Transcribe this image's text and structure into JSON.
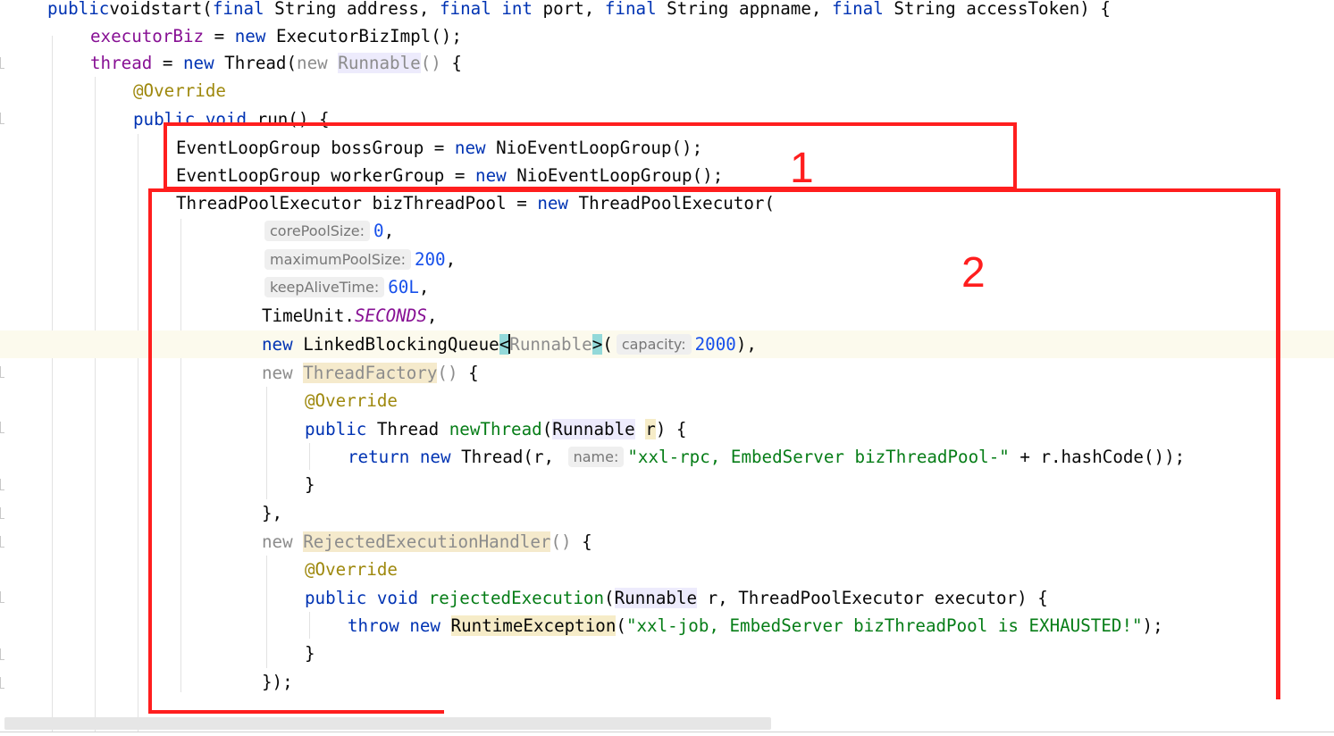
{
  "editor": {
    "lines": [
      {
        "tokens": [
          [
            "kw",
            "public"
          ],
          [
            "",
            "void"
          ],
          [
            "",
            "start("
          ],
          [
            "kw",
            "final"
          ],
          [
            "",
            " String address, "
          ],
          [
            "kw",
            "final"
          ],
          [
            "",
            " "
          ],
          [
            "kw",
            "int"
          ],
          [
            "",
            " port, "
          ],
          [
            "kw",
            "final"
          ],
          [
            "",
            " String appname, "
          ],
          [
            "kw",
            "final"
          ],
          [
            "",
            " String accessToken) {"
          ]
        ]
      },
      {
        "tokens": [
          [
            "fld",
            "executorBiz"
          ],
          [
            "",
            " = "
          ],
          [
            "kw",
            "new"
          ],
          [
            "",
            " ExecutorBizImpl();"
          ]
        ]
      },
      {
        "tokens": [
          [
            "fld",
            "thread"
          ],
          [
            "",
            " = "
          ],
          [
            "kw",
            "new"
          ],
          [
            "",
            " Thread("
          ],
          [
            "gray",
            "new "
          ],
          [
            "gray hl-violet",
            "Runnable"
          ],
          [
            "gray",
            "()"
          ],
          [
            "",
            " {"
          ]
        ]
      },
      {
        "tokens": [
          [
            "ann",
            "@Override"
          ]
        ]
      },
      {
        "tokens": [
          [
            "kw",
            "public"
          ],
          [
            "",
            " "
          ],
          [
            "kw",
            "void"
          ],
          [
            "",
            " run() {"
          ]
        ]
      },
      {
        "tokens": [
          [
            "",
            "EventLoopGroup bossGroup = "
          ],
          [
            "kw",
            "new"
          ],
          [
            "",
            " NioEventLoopGroup();"
          ]
        ]
      },
      {
        "tokens": [
          [
            "",
            "EventLoopGroup workerGroup = "
          ],
          [
            "kw",
            "new"
          ],
          [
            "",
            " NioEventLoopGroup();"
          ]
        ]
      },
      {
        "tokens": [
          [
            "",
            "ThreadPoolExecutor bizThreadPool = "
          ],
          [
            "kw",
            "new"
          ],
          [
            "",
            " ThreadPoolExecutor("
          ]
        ]
      },
      {
        "hint": "corePoolSize:",
        "tokens": [
          [
            "num",
            "0"
          ],
          [
            "",
            ","
          ]
        ]
      },
      {
        "hint": "maximumPoolSize:",
        "tokens": [
          [
            "num",
            "200"
          ],
          [
            "",
            ","
          ]
        ]
      },
      {
        "hint": "keepAliveTime:",
        "tokens": [
          [
            "num",
            "60L"
          ],
          [
            "",
            ","
          ]
        ]
      },
      {
        "tokens": [
          [
            "",
            "TimeUnit."
          ],
          [
            "ital-const",
            "SECONDS"
          ],
          [
            "",
            ","
          ]
        ]
      },
      {
        "current": true,
        "tokens": [
          [
            "kw",
            "new"
          ],
          [
            "",
            " LinkedBlockingQueue"
          ],
          [
            "cyan",
            "<"
          ],
          [
            "caret",
            ""
          ],
          [
            "gray",
            "Runnable"
          ],
          [
            "cyan",
            ">"
          ],
          [
            "",
            "("
          ]
        ],
        "hint2": "capacity:",
        "tokens2": [
          [
            "num",
            "2000"
          ],
          [
            "",
            "),"
          ]
        ]
      },
      {
        "tokens": [
          [
            "gray",
            "new "
          ],
          [
            "gray hl-yellow",
            "ThreadFactory"
          ],
          [
            "gray",
            "()"
          ],
          [
            "",
            " {"
          ]
        ]
      },
      {
        "tokens": [
          [
            "ann",
            "@Override"
          ]
        ]
      },
      {
        "tokens": [
          [
            "kw",
            "public"
          ],
          [
            "",
            " Thread "
          ],
          [
            "str",
            "newThread"
          ],
          [
            "",
            "("
          ],
          [
            "hl-violet",
            "Runnable"
          ],
          [
            "",
            " "
          ],
          [
            "hl-soft",
            "r"
          ],
          [
            "",
            ") {"
          ]
        ]
      },
      {
        "tokens": [
          [
            "kw",
            "return"
          ],
          [
            "",
            " "
          ],
          [
            "kw",
            "new"
          ],
          [
            "",
            " Thread(r, "
          ]
        ],
        "hint2": "name:",
        "tokens2": [
          [
            "str",
            "\"xxl-rpc, EmbedServer bizThreadPool-\""
          ],
          [
            "",
            " + r.hashCode());"
          ]
        ]
      },
      {
        "tokens": [
          [
            "",
            "}"
          ]
        ]
      },
      {
        "tokens": [
          [
            "",
            "},"
          ]
        ]
      },
      {
        "tokens": [
          [
            "gray",
            "new "
          ],
          [
            "gray hl-yellow",
            "RejectedExecutionHandler"
          ],
          [
            "gray",
            "()"
          ],
          [
            "",
            " {"
          ]
        ]
      },
      {
        "tokens": [
          [
            "ann",
            "@Override"
          ]
        ]
      },
      {
        "tokens": [
          [
            "kw",
            "public"
          ],
          [
            "",
            " "
          ],
          [
            "kw",
            "void"
          ],
          [
            "",
            " "
          ],
          [
            "str",
            "rejectedExecution"
          ],
          [
            "",
            "("
          ],
          [
            "hl-violet",
            "Runnable"
          ],
          [
            "",
            " r, ThreadPoolExecutor executor) {"
          ]
        ]
      },
      {
        "tokens": [
          [
            "kw",
            "throw"
          ],
          [
            "",
            " "
          ],
          [
            "kw",
            "new"
          ],
          [
            "",
            " "
          ],
          [
            "hl-soft",
            "RuntimeException"
          ],
          [
            "",
            "("
          ],
          [
            "str",
            "\"xxl-job, EmbedServer bizThreadPool is EXHAUSTED!\""
          ],
          [
            "",
            ");"
          ]
        ]
      },
      {
        "tokens": [
          [
            "",
            "}"
          ]
        ]
      },
      {
        "tokens": [
          [
            "",
            "});"
          ]
        ]
      }
    ]
  },
  "annotations": {
    "box1_label": "1",
    "box2_label": "2",
    "color": "#ff1e1e"
  },
  "icons": [
    "fold-marker-icon"
  ]
}
